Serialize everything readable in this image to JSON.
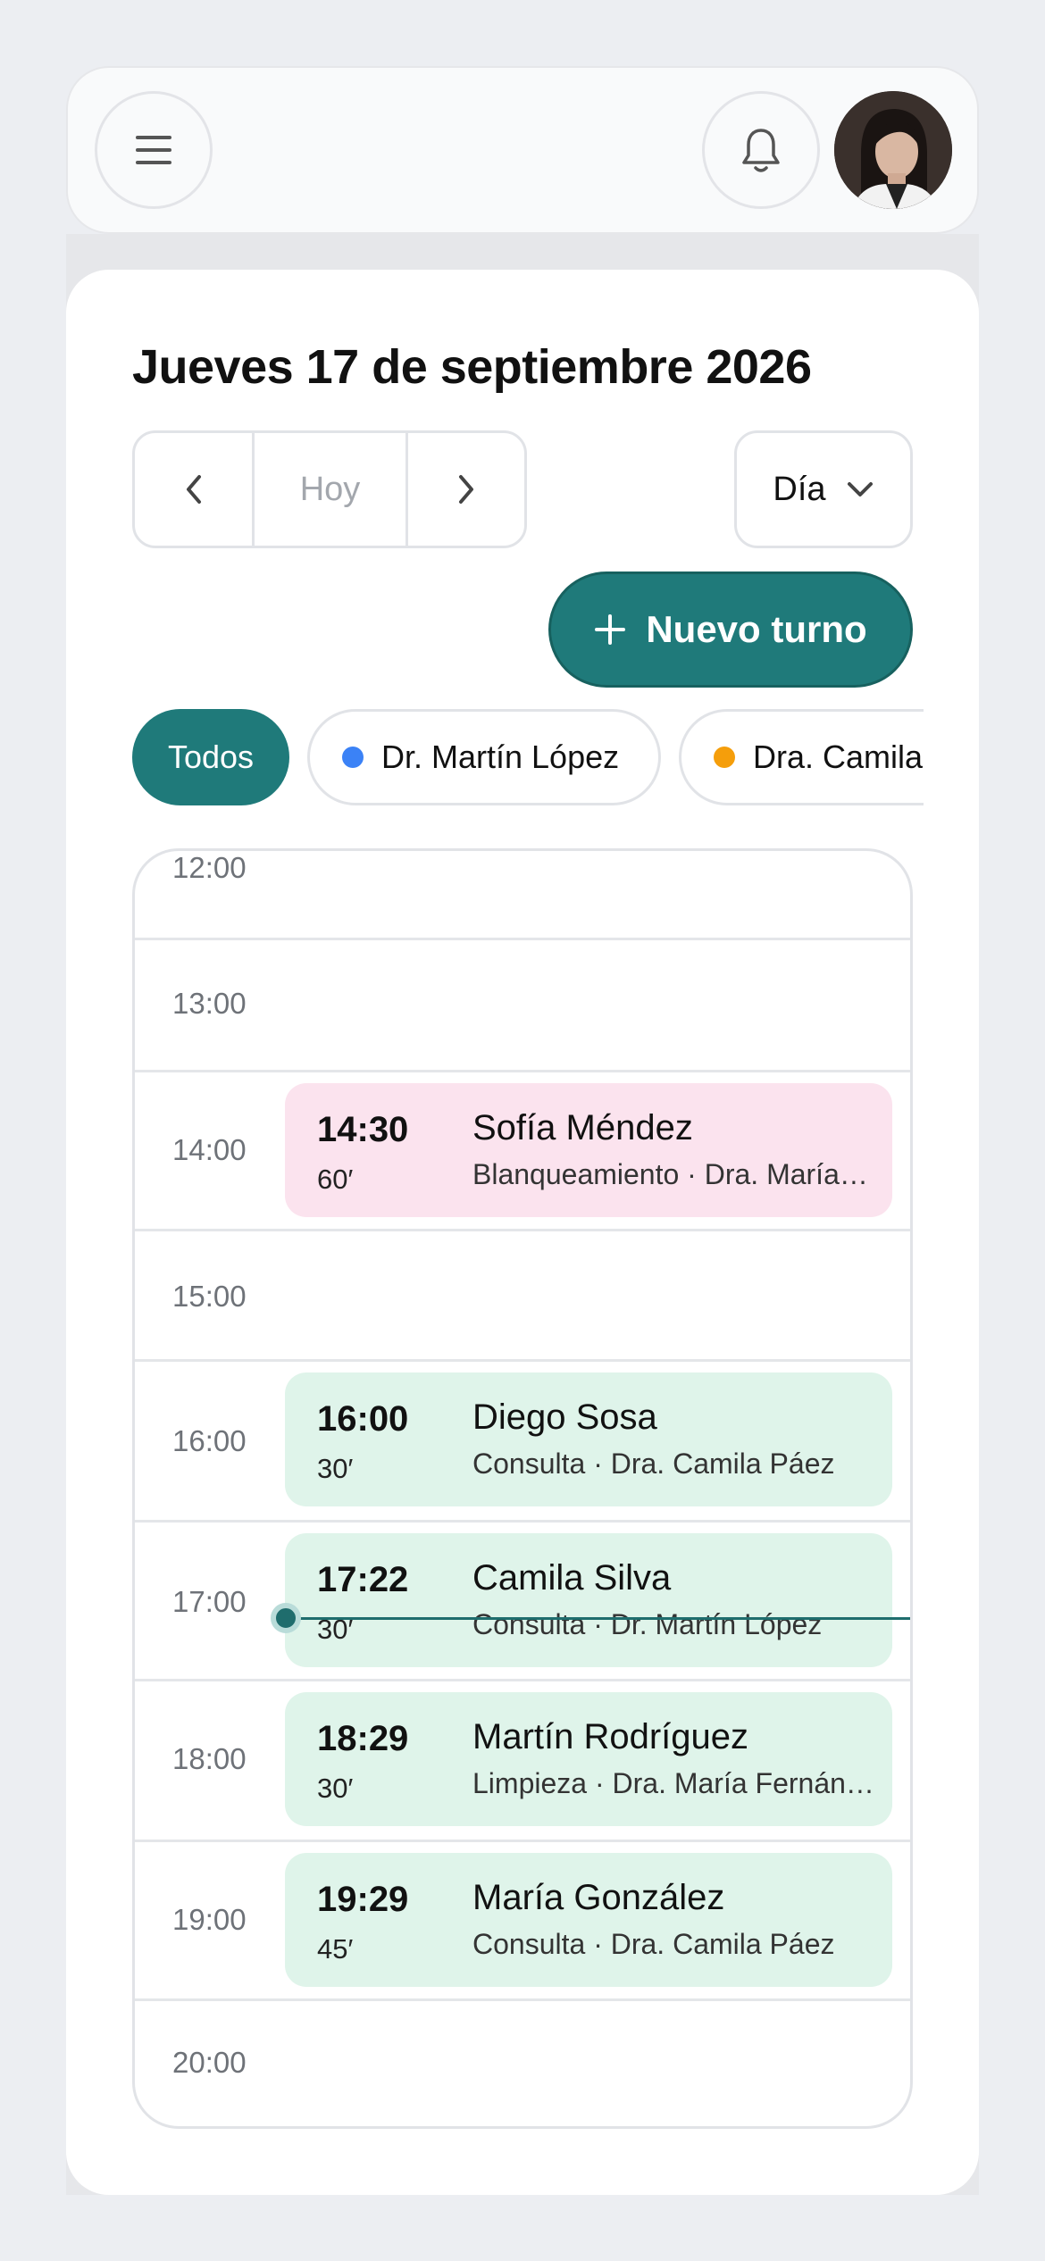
{
  "header": {
    "menu_icon": "menu-icon",
    "bell_icon": "bell-icon",
    "avatar_alt": "avatar"
  },
  "calendar": {
    "title": "Jueves 17 de septiembre 2026",
    "nav": {
      "prev_icon": "chevron-left-icon",
      "today_label": "Hoy",
      "next_icon": "chevron-right-icon"
    },
    "view": {
      "selected": "Día",
      "icon": "chevron-down-icon"
    },
    "new_button": {
      "label": "Nuevo turno",
      "icon": "plus-icon"
    },
    "filters": [
      {
        "label": "Todos",
        "active": true
      },
      {
        "label": "Dr. Martín López",
        "color": "#3b82f6"
      },
      {
        "label": "Dra. Camila",
        "color": "#f59e0b"
      }
    ],
    "hours": [
      "12:00",
      "13:00",
      "14:00",
      "15:00",
      "16:00",
      "17:00",
      "18:00",
      "19:00",
      "20:00"
    ],
    "appointments": [
      {
        "time": "14:30",
        "duration": "60′",
        "patient": "Sofía Méndez",
        "detail": "Blanqueamiento · Dra. María Fernández",
        "color": "pink"
      },
      {
        "time": "16:00",
        "duration": "30′",
        "patient": "Diego Sosa",
        "detail": "Consulta · Dra. Camila Páez",
        "color": "mint"
      },
      {
        "time": "17:22",
        "duration": "30′",
        "patient": "Camila Silva",
        "detail": "Consulta · Dr. Martín López",
        "color": "mint"
      },
      {
        "time": "18:29",
        "duration": "30′",
        "patient": "Martín Rodríguez",
        "detail": "Limpieza · Dra. María Fernández",
        "color": "mint"
      },
      {
        "time": "19:29",
        "duration": "45′",
        "patient": "María González",
        "detail": "Consulta · Dra. Camila Páez",
        "color": "mint"
      }
    ]
  },
  "colors": {
    "accent": "#1f7a7a",
    "pink_card": "#fbe3ee",
    "mint_card": "#dff4ea"
  }
}
